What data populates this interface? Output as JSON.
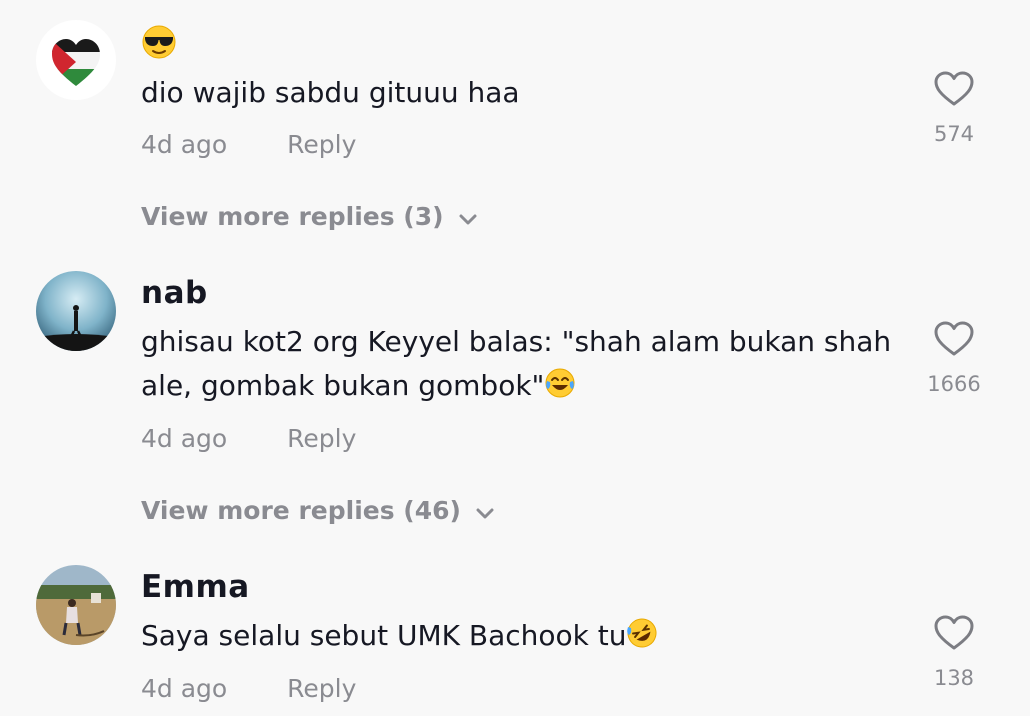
{
  "comments": [
    {
      "username": "",
      "emoji_line": "sunglasses-emoji",
      "text": "dio wajib sabdu gituuu haa",
      "time": "4d ago",
      "reply_label": "Reply",
      "likes": "574",
      "more_replies": "View more replies (3)"
    },
    {
      "username": "nab",
      "text_line1": "ghisau kot2 org Keyyel balas: \"shah alam bukan shah",
      "text_line2": "ale, gombak bukan gombok\"",
      "trailing_emoji": "tears-of-joy-emoji",
      "time": "4d ago",
      "reply_label": "Reply",
      "likes": "1666",
      "more_replies": "View more replies (46)"
    },
    {
      "username": "Emma",
      "text": "Saya selalu sebut UMK Bachook tu",
      "trailing_emoji": "rolling-laughing-emoji",
      "time": "4d ago",
      "reply_label": "Reply",
      "likes": "138"
    }
  ],
  "colors": {
    "background": "#f8f8f8",
    "primary_text": "#161823",
    "secondary_text": "#8a8b91",
    "heart_outline": "#7c7d83"
  }
}
